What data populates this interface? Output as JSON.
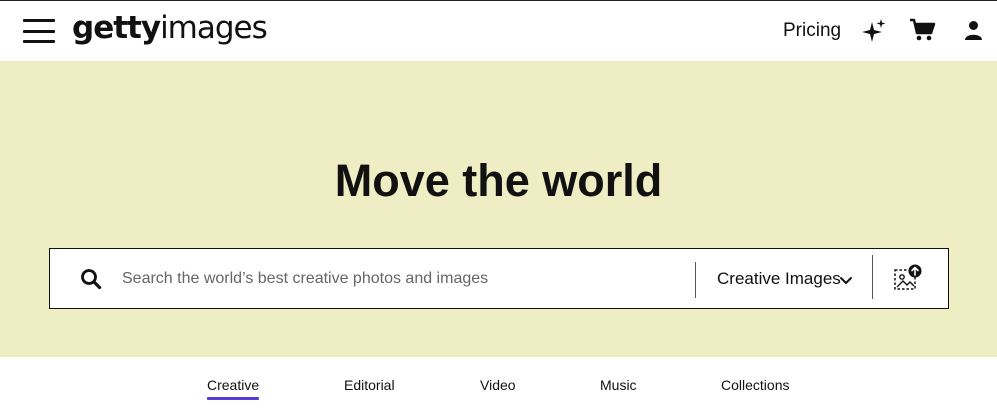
{
  "header": {
    "logo": {
      "bold_part": "getty",
      "light_part": "images"
    },
    "menu_icon": "hamburger-menu-icon",
    "pricing_label": "Pricing",
    "icons": [
      "sparkle-icon",
      "cart-icon",
      "user-icon"
    ]
  },
  "hero": {
    "headline": "Move the world",
    "background_color": "#eeedc4"
  },
  "search": {
    "placeholder": "Search the world’s best creative photos and images",
    "value": "",
    "type_selected": "Creative Images",
    "icons": [
      "search-icon",
      "chevron-down-icon",
      "visual-search-icon"
    ]
  },
  "tabs": {
    "items": [
      {
        "label": "Creative",
        "active": true
      },
      {
        "label": "Editorial",
        "active": false
      },
      {
        "label": "Video",
        "active": false
      },
      {
        "label": "Music",
        "active": false
      },
      {
        "label": "Collections",
        "active": false
      }
    ],
    "accent_color": "#5a3bd6"
  }
}
